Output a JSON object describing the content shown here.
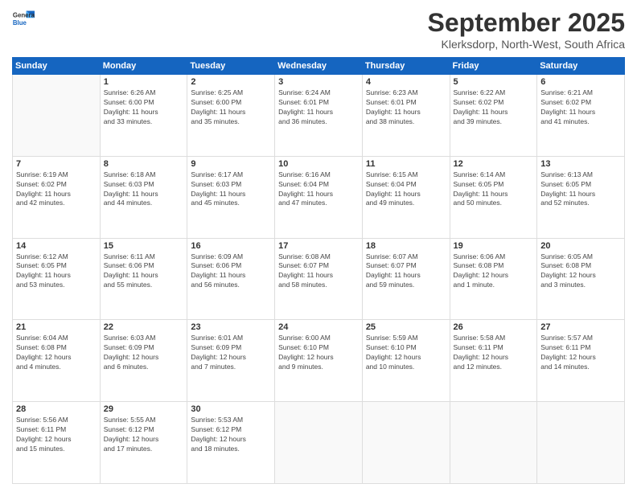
{
  "logo": {
    "line1": "General",
    "line2": "Blue"
  },
  "title": "September 2025",
  "subtitle": "Klerksdorp, North-West, South Africa",
  "days_header": [
    "Sunday",
    "Monday",
    "Tuesday",
    "Wednesday",
    "Thursday",
    "Friday",
    "Saturday"
  ],
  "weeks": [
    [
      {
        "num": "",
        "info": ""
      },
      {
        "num": "1",
        "info": "Sunrise: 6:26 AM\nSunset: 6:00 PM\nDaylight: 11 hours\nand 33 minutes."
      },
      {
        "num": "2",
        "info": "Sunrise: 6:25 AM\nSunset: 6:00 PM\nDaylight: 11 hours\nand 35 minutes."
      },
      {
        "num": "3",
        "info": "Sunrise: 6:24 AM\nSunset: 6:01 PM\nDaylight: 11 hours\nand 36 minutes."
      },
      {
        "num": "4",
        "info": "Sunrise: 6:23 AM\nSunset: 6:01 PM\nDaylight: 11 hours\nand 38 minutes."
      },
      {
        "num": "5",
        "info": "Sunrise: 6:22 AM\nSunset: 6:02 PM\nDaylight: 11 hours\nand 39 minutes."
      },
      {
        "num": "6",
        "info": "Sunrise: 6:21 AM\nSunset: 6:02 PM\nDaylight: 11 hours\nand 41 minutes."
      }
    ],
    [
      {
        "num": "7",
        "info": "Sunrise: 6:19 AM\nSunset: 6:02 PM\nDaylight: 11 hours\nand 42 minutes."
      },
      {
        "num": "8",
        "info": "Sunrise: 6:18 AM\nSunset: 6:03 PM\nDaylight: 11 hours\nand 44 minutes."
      },
      {
        "num": "9",
        "info": "Sunrise: 6:17 AM\nSunset: 6:03 PM\nDaylight: 11 hours\nand 45 minutes."
      },
      {
        "num": "10",
        "info": "Sunrise: 6:16 AM\nSunset: 6:04 PM\nDaylight: 11 hours\nand 47 minutes."
      },
      {
        "num": "11",
        "info": "Sunrise: 6:15 AM\nSunset: 6:04 PM\nDaylight: 11 hours\nand 49 minutes."
      },
      {
        "num": "12",
        "info": "Sunrise: 6:14 AM\nSunset: 6:05 PM\nDaylight: 11 hours\nand 50 minutes."
      },
      {
        "num": "13",
        "info": "Sunrise: 6:13 AM\nSunset: 6:05 PM\nDaylight: 11 hours\nand 52 minutes."
      }
    ],
    [
      {
        "num": "14",
        "info": "Sunrise: 6:12 AM\nSunset: 6:05 PM\nDaylight: 11 hours\nand 53 minutes."
      },
      {
        "num": "15",
        "info": "Sunrise: 6:11 AM\nSunset: 6:06 PM\nDaylight: 11 hours\nand 55 minutes."
      },
      {
        "num": "16",
        "info": "Sunrise: 6:09 AM\nSunset: 6:06 PM\nDaylight: 11 hours\nand 56 minutes."
      },
      {
        "num": "17",
        "info": "Sunrise: 6:08 AM\nSunset: 6:07 PM\nDaylight: 11 hours\nand 58 minutes."
      },
      {
        "num": "18",
        "info": "Sunrise: 6:07 AM\nSunset: 6:07 PM\nDaylight: 11 hours\nand 59 minutes."
      },
      {
        "num": "19",
        "info": "Sunrise: 6:06 AM\nSunset: 6:08 PM\nDaylight: 12 hours\nand 1 minute."
      },
      {
        "num": "20",
        "info": "Sunrise: 6:05 AM\nSunset: 6:08 PM\nDaylight: 12 hours\nand 3 minutes."
      }
    ],
    [
      {
        "num": "21",
        "info": "Sunrise: 6:04 AM\nSunset: 6:08 PM\nDaylight: 12 hours\nand 4 minutes."
      },
      {
        "num": "22",
        "info": "Sunrise: 6:03 AM\nSunset: 6:09 PM\nDaylight: 12 hours\nand 6 minutes."
      },
      {
        "num": "23",
        "info": "Sunrise: 6:01 AM\nSunset: 6:09 PM\nDaylight: 12 hours\nand 7 minutes."
      },
      {
        "num": "24",
        "info": "Sunrise: 6:00 AM\nSunset: 6:10 PM\nDaylight: 12 hours\nand 9 minutes."
      },
      {
        "num": "25",
        "info": "Sunrise: 5:59 AM\nSunset: 6:10 PM\nDaylight: 12 hours\nand 10 minutes."
      },
      {
        "num": "26",
        "info": "Sunrise: 5:58 AM\nSunset: 6:11 PM\nDaylight: 12 hours\nand 12 minutes."
      },
      {
        "num": "27",
        "info": "Sunrise: 5:57 AM\nSunset: 6:11 PM\nDaylight: 12 hours\nand 14 minutes."
      }
    ],
    [
      {
        "num": "28",
        "info": "Sunrise: 5:56 AM\nSunset: 6:11 PM\nDaylight: 12 hours\nand 15 minutes."
      },
      {
        "num": "29",
        "info": "Sunrise: 5:55 AM\nSunset: 6:12 PM\nDaylight: 12 hours\nand 17 minutes."
      },
      {
        "num": "30",
        "info": "Sunrise: 5:53 AM\nSunset: 6:12 PM\nDaylight: 12 hours\nand 18 minutes."
      },
      {
        "num": "",
        "info": ""
      },
      {
        "num": "",
        "info": ""
      },
      {
        "num": "",
        "info": ""
      },
      {
        "num": "",
        "info": ""
      }
    ]
  ]
}
